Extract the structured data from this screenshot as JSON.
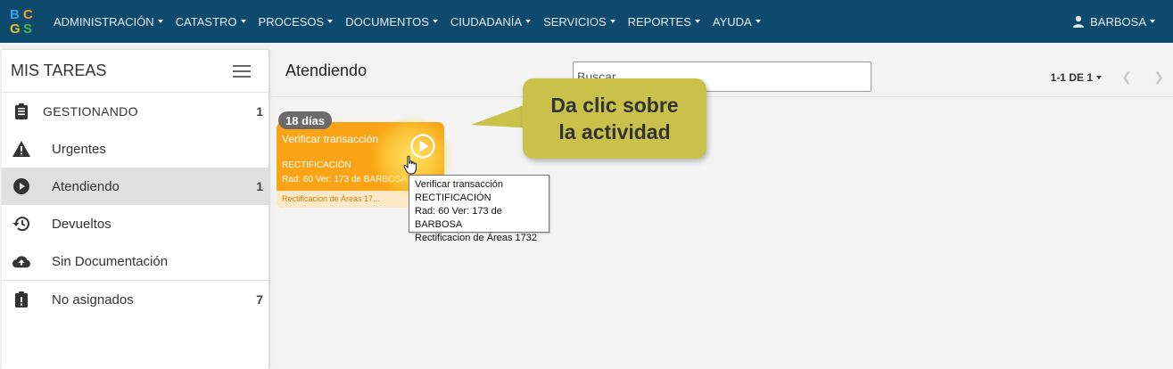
{
  "app": {
    "logo_text": "BCGS"
  },
  "topbar": {
    "menu": [
      {
        "label": "ADMINISTRACIÓN"
      },
      {
        "label": "CATASTRO"
      },
      {
        "label": "PROCESOS"
      },
      {
        "label": "DOCUMENTOS"
      },
      {
        "label": "CIUDADANÍA"
      },
      {
        "label": "SERVICIOS"
      },
      {
        "label": "REPORTES"
      },
      {
        "label": "AYUDA"
      }
    ],
    "user": "BARBOSA",
    "colors": {
      "background": "#0e4a6e"
    }
  },
  "sidebar": {
    "title": "MIS TAREAS",
    "items": [
      {
        "label": "GESTIONANDO",
        "count": "1",
        "icon": "clipboard-icon"
      },
      {
        "label": "Urgentes",
        "count": "",
        "icon": "warning-icon"
      },
      {
        "label": "Atendiendo",
        "count": "1",
        "icon": "play-circle-icon"
      },
      {
        "label": "Devueltos",
        "count": "",
        "icon": "history-icon"
      },
      {
        "label": "Sin Documentación",
        "count": "",
        "icon": "cloud-upload-icon"
      },
      {
        "label": "No asignados",
        "count": "7",
        "icon": "clipboard-alert-icon"
      }
    ],
    "active_item": "Atendiendo"
  },
  "main": {
    "title": "Atendiendo",
    "search": {
      "placeholder": "Buscar",
      "value": ""
    },
    "pagination": {
      "label": "1-1 DE 1"
    }
  },
  "task_card": {
    "days_badge": "18 días",
    "title": "Verificar transacción",
    "type": "RECTIFICACIÓN",
    "rad": "Rad: 60 Ver: 173 de BARBOSA",
    "footer": "Rectificacion de Áreas 17...",
    "colors": {
      "card": "#f9a316",
      "footer_bg": "#fde9c8"
    }
  },
  "tooltip": {
    "lines": [
      "Verificar transacción",
      "RECTIFICACIÓN",
      "Rad: 60 Ver: 173 de BARBOSA",
      "Rectificacion de Áreas 1732"
    ]
  },
  "callout": {
    "line1": "Da clic sobre",
    "line2": "la actividad",
    "color": "#c9c14a"
  }
}
